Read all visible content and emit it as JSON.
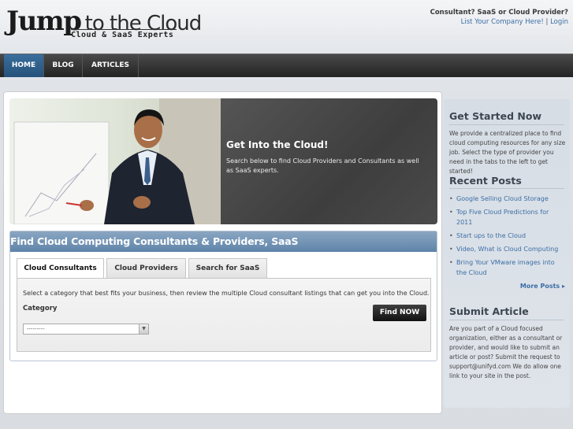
{
  "header": {
    "logo_main": "Jump",
    "logo_rest": "to the Cloud",
    "logo_sub": "Cloud & SaaS Experts",
    "question": "Consultant? SaaS or Cloud Provider?",
    "list_link": "List Your Company Here!",
    "separator": "|",
    "login_link": "Login"
  },
  "nav": {
    "home": "HOME",
    "blog": "BLOG",
    "articles": "ARTICLES"
  },
  "hero": {
    "title": "Get Into the Cloud!",
    "text": "Search below to find Cloud Providers and Consultants as well as SaaS experts."
  },
  "finder": {
    "title": "Find Cloud Computing Consultants & Providers, SaaS",
    "tabs": [
      "Cloud Consultants",
      "Cloud Providers",
      "Search for SaaS"
    ],
    "instructions": "Select a category that best fits your business, then review the multiple Cloud consultant listings that can get you into the Cloud.",
    "category_label": "Category",
    "category_value": "---------",
    "button": "Find NOW"
  },
  "sidebar": {
    "get_started_title": "Get Started Now",
    "get_started_text": "We provide a centralized place to find cloud computing resources for any size job. Select the type of provider you need in the tabs to the left to get started!",
    "recent_title": "Recent Posts",
    "posts": [
      "Google Selling Cloud Storage",
      "Top Five Cloud Predictions for 2011",
      "Start ups to the Cloud",
      "Video, What is Cloud Computing",
      "Bring Your VMware images into the Cloud"
    ],
    "more": "More Posts ▸",
    "submit_title": "Submit Article",
    "submit_text": "Are you part of a Cloud focused organization, either as a consultant or provider, and would like to submit an article or post? Submit the request to support@unifyd.com We do allow one link to your site in the post."
  }
}
